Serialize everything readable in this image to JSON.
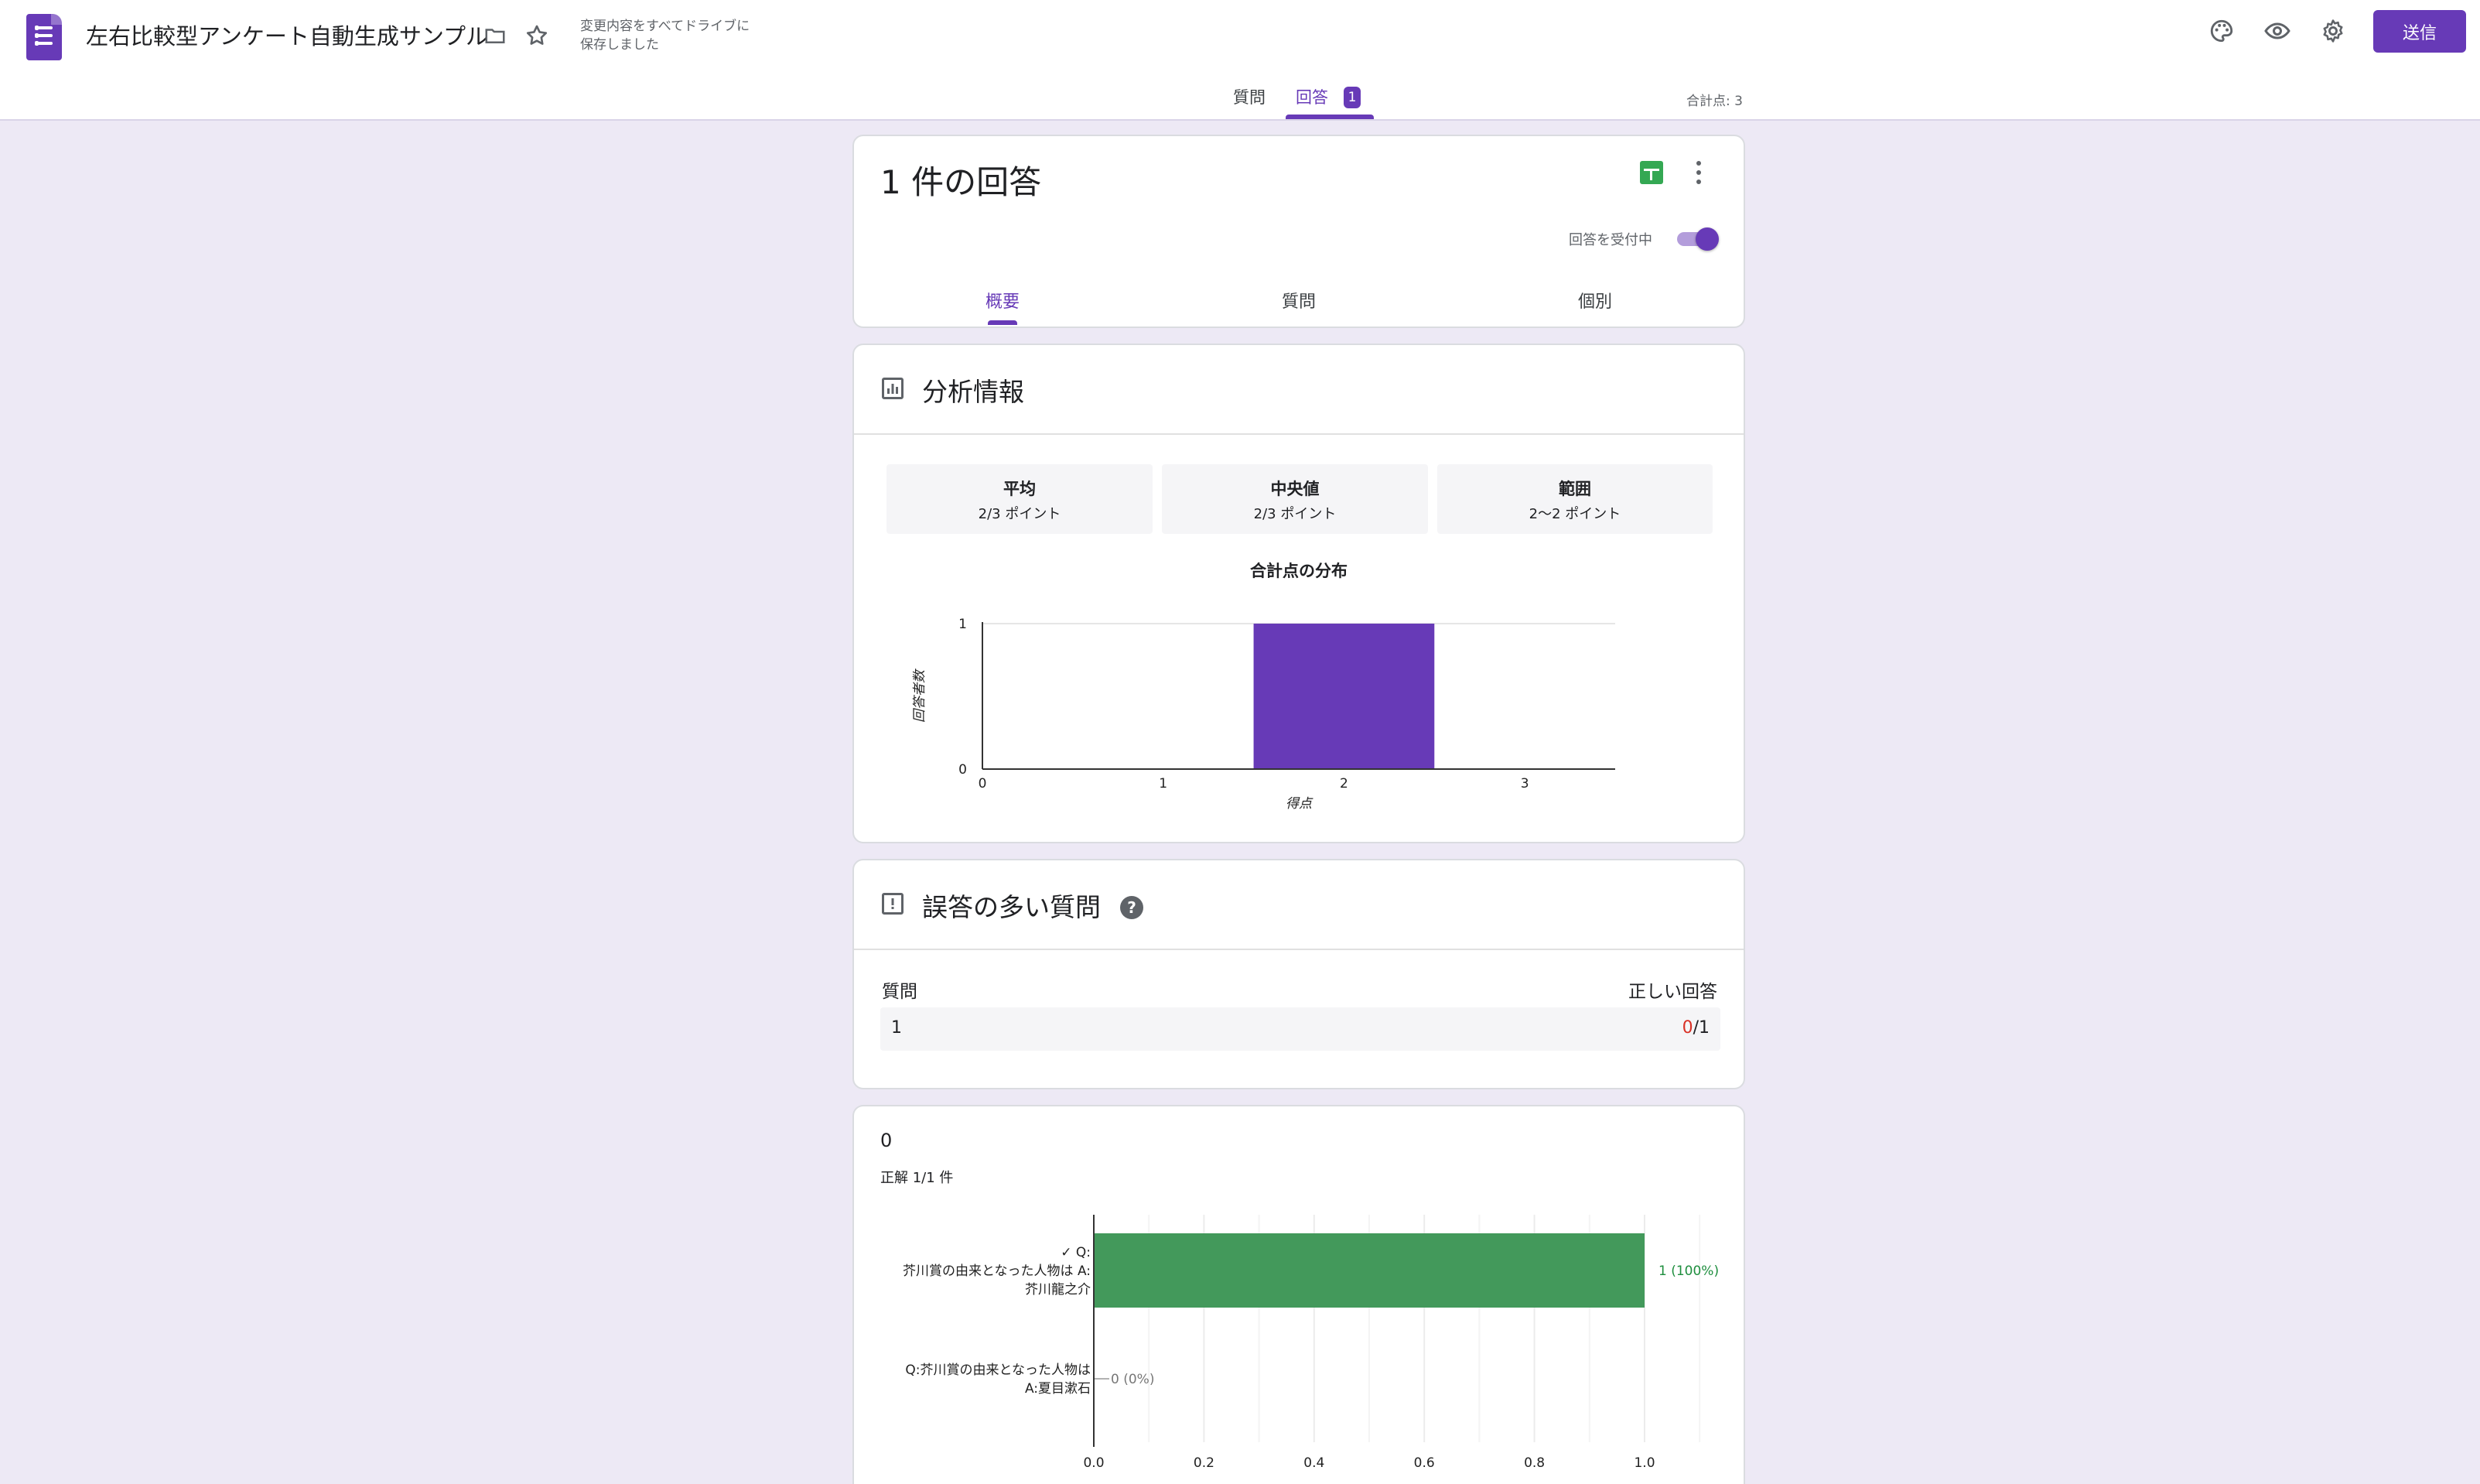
{
  "header": {
    "title": "左右比較型アンケート自動生成サンプル",
    "saved_line1": "変更内容をすべてドライブに",
    "saved_line2": "保存しました",
    "send_label": "送信",
    "icons": [
      "forms-logo-icon",
      "folder-icon",
      "star-icon",
      "palette-icon",
      "eye-icon",
      "gear-icon"
    ]
  },
  "tabs": {
    "questions": "質問",
    "responses": "回答",
    "responses_badge": "1",
    "total_points": "合計点: 3"
  },
  "summary_card": {
    "count_title": "1 件の回答",
    "accepting_label": "回答を受付中",
    "accepting": true,
    "subtabs": [
      "概要",
      "質問",
      "個別"
    ],
    "active_subtab": "概要"
  },
  "insights": {
    "title": "分析情報",
    "stats": [
      {
        "label": "平均",
        "value": "2/3 ポイント"
      },
      {
        "label": "中央値",
        "value": "2/3 ポイント"
      },
      {
        "label": "範囲",
        "value": "2〜2 ポイント"
      }
    ],
    "chart_title": "合計点の分布"
  },
  "missed": {
    "title": "誤答の多い質問",
    "col_question": "質問",
    "col_correct": "正しい回答",
    "row_question": "1",
    "row_correct_num": "0",
    "row_correct_den": "/1"
  },
  "question_card": {
    "title": "0",
    "subtitle": "正解 1/1 件"
  },
  "colors": {
    "accent": "#673ab7",
    "bar_green": "#43995b",
    "incorrect_red": "#d93025"
  },
  "chart_data": [
    {
      "type": "bar",
      "title": "合計点の分布",
      "xlabel": "得点",
      "ylabel": "回答者数",
      "categories": [
        "0",
        "1",
        "2",
        "3"
      ],
      "values": [
        0,
        0,
        1,
        0
      ],
      "ylim": [
        0,
        1
      ],
      "yticks": [
        "0",
        "1"
      ]
    },
    {
      "type": "bar",
      "orientation": "horizontal",
      "categories": [
        "✓ Q:\n芥川賞の由来となった人物は A:\n芥川龍之介",
        "Q:芥川賞の由来となった人物は\nA:夏目漱石"
      ],
      "values": [
        1,
        0
      ],
      "data_labels": [
        "1 (100%)",
        "0 (0%)"
      ],
      "xlim": [
        0,
        1
      ],
      "xticks": [
        "0.0",
        "0.2",
        "0.4",
        "0.6",
        "0.8",
        "1.0"
      ]
    }
  ]
}
